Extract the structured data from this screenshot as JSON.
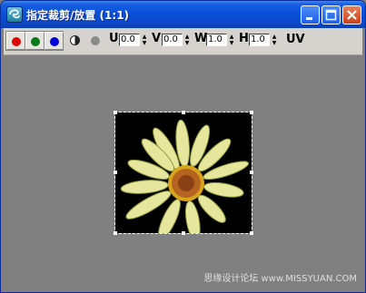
{
  "window": {
    "title": "指定裁剪/放置 (1:1)",
    "icon": "app-icon"
  },
  "toolbar": {
    "channels": [
      {
        "name": "red-channel",
        "color": "#e00000",
        "selected": true
      },
      {
        "name": "green-channel",
        "color": "#007a1a",
        "selected": true
      },
      {
        "name": "blue-channel",
        "color": "#0000d8",
        "selected": true
      }
    ],
    "mono_icon": "monochrome-toggle-icon",
    "alpha_icon": "alpha-toggle-icon",
    "fields": {
      "u": {
        "label": "U",
        "value": "0.0"
      },
      "v": {
        "label": "V",
        "value": "0.0"
      },
      "w": {
        "label": "W",
        "value": "1.0"
      },
      "h": {
        "label": "H",
        "value": "1.0"
      }
    },
    "uv_label": "UV"
  },
  "canvas": {
    "image": "daisy-flower-image",
    "background": "#808080"
  },
  "watermark": "思缘设计论坛 www.MISSYUAN.COM"
}
